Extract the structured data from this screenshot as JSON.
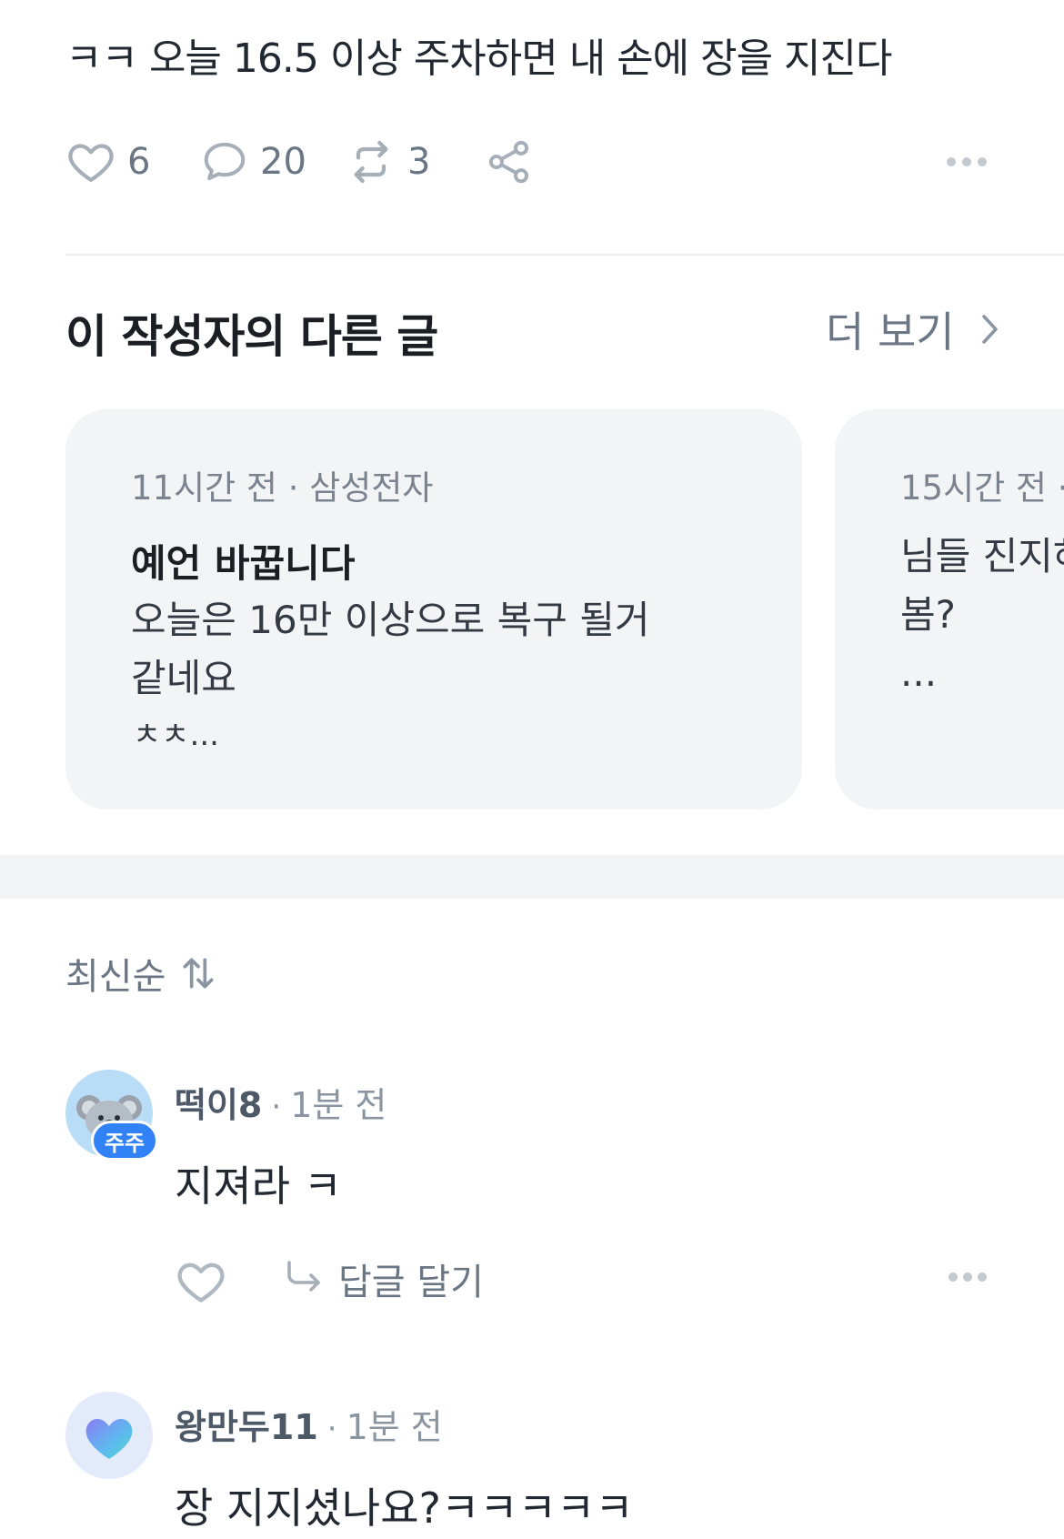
{
  "post": {
    "text": "ㅋㅋ 오늘 16.5 이상 주차하면 내 손에 장을 지진다",
    "like_count": "6",
    "comment_count": "20",
    "repost_count": "3"
  },
  "related": {
    "title": "이 작성자의 다른 글",
    "see_more_label": "더 보기",
    "cards": [
      {
        "meta": "11시간 전 · 삼성전자",
        "title": "예언 바꿉니다",
        "body": "오늘은 16만 이상으로 복구 될거\n같네요",
        "ellipsis": "ㅊㅊ..."
      },
      {
        "meta": "15시간 전 ·",
        "body": "님들 진지하\n봄?\n..."
      }
    ]
  },
  "comments_section": {
    "sort_label": "최신순",
    "comments": [
      {
        "author": "떡이8",
        "separator": "·",
        "time": "1분 전",
        "badge": "주주",
        "text": "지져라 ㅋ",
        "reply_label": "답글 달기"
      },
      {
        "author": "왕만두11",
        "separator": "·",
        "time": "1분 전",
        "text": "장 지지셨나요?ㅋㅋㅋㅋㅋ"
      }
    ]
  },
  "colors": {
    "icon": "#a6aeb8",
    "accent_badge": "#3182f6",
    "card_bg": "#f2f4f6"
  }
}
